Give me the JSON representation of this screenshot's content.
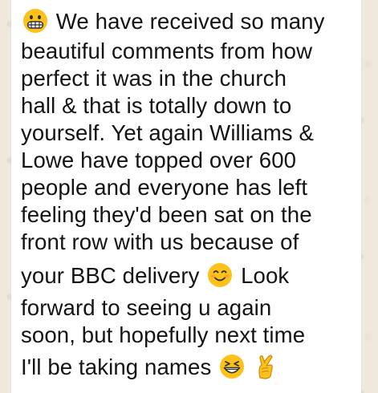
{
  "chat": {
    "bubble_color": "#ffffff",
    "wallpaper_color": "#efe8dc",
    "message": {
      "line1": "We have received so many",
      "line2": "beautiful comments from how",
      "line3": "perfect it was in the church",
      "line4": "hall & that is totally down to",
      "line5": "yourself. Yet again Williams &",
      "line6": "Lowe have topped over 600",
      "line7": "people and everyone has left",
      "line8": "feeling they'd been sat on the",
      "line9": "front row with us because of",
      "line10_a": "your BBC delivery",
      "line10_b": "Look",
      "line11": "forward to seeing u again",
      "line12": "soon, but hopefully next time",
      "line13": "I'll be taking names"
    },
    "emojis": {
      "grimacing": "grimacing-face-icon",
      "smiling": "smiling-face-icon",
      "grinning": "grinning-squinting-face-icon",
      "crossed_fingers": "crossed-fingers-icon"
    }
  }
}
